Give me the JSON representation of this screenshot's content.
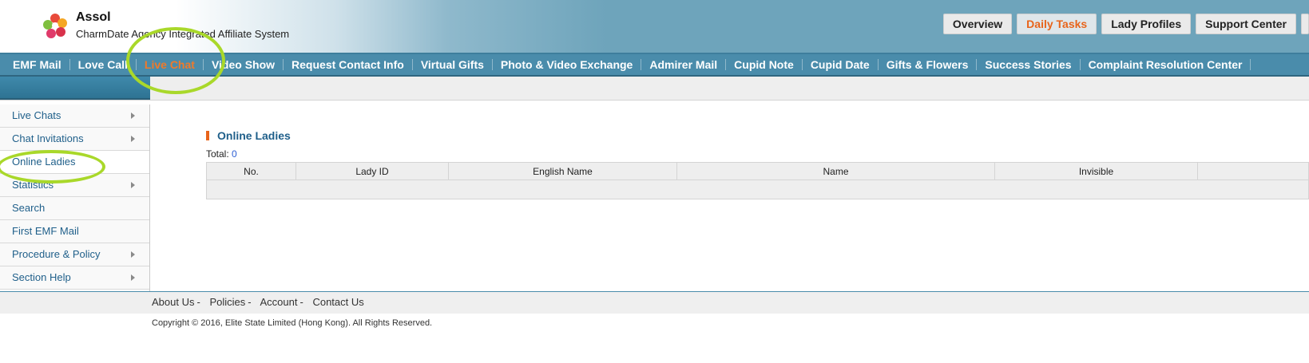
{
  "header": {
    "brand_name": "Assol",
    "brand_subtitle": "CharmDate Agency Integrated Affiliate System",
    "buttons": [
      {
        "label": "Overview",
        "active": false
      },
      {
        "label": "Daily Tasks",
        "active": true
      },
      {
        "label": "Lady Profiles",
        "active": false
      },
      {
        "label": "Support Center",
        "active": false
      }
    ]
  },
  "nav": {
    "items": [
      {
        "label": "EMF Mail"
      },
      {
        "label": "Love Call"
      },
      {
        "label": "Live Chat",
        "active": true
      },
      {
        "label": "Video Show"
      },
      {
        "label": "Request Contact Info"
      },
      {
        "label": "Virtual Gifts"
      },
      {
        "label": "Photo & Video Exchange"
      },
      {
        "label": "Admirer Mail"
      },
      {
        "label": "Cupid Note"
      },
      {
        "label": "Cupid Date"
      },
      {
        "label": "Gifts & Flowers"
      },
      {
        "label": "Success Stories"
      },
      {
        "label": "Complaint Resolution Center"
      }
    ]
  },
  "sidebar": {
    "items": [
      {
        "label": "Live Chats",
        "arrow": true
      },
      {
        "label": "Chat Invitations",
        "arrow": true
      },
      {
        "label": "Online Ladies",
        "arrow": false,
        "selected": true
      },
      {
        "label": "Statistics",
        "arrow": true
      },
      {
        "label": "Search",
        "arrow": false
      },
      {
        "label": "First EMF Mail",
        "arrow": false
      },
      {
        "label": "Procedure & Policy",
        "arrow": true
      },
      {
        "label": "Section Help",
        "arrow": true
      }
    ]
  },
  "main": {
    "title": "Online Ladies",
    "total_label": "Total:",
    "total_value": "0",
    "table": {
      "columns": [
        "No.",
        "Lady ID",
        "English Name",
        "Name",
        "Invisible",
        ""
      ]
    }
  },
  "footer": {
    "links": [
      "About Us",
      "Policies",
      "Account",
      "Contact Us"
    ],
    "separator": "-",
    "copyright": "Copyright © 2016, Elite State Limited (Hong Kong). All Rights Reserved."
  },
  "colors": {
    "nav_bg": "#4a8cab",
    "accent_orange": "#e8641b",
    "link_blue": "#1f5f8a",
    "annotation_green": "#a9d82a"
  }
}
